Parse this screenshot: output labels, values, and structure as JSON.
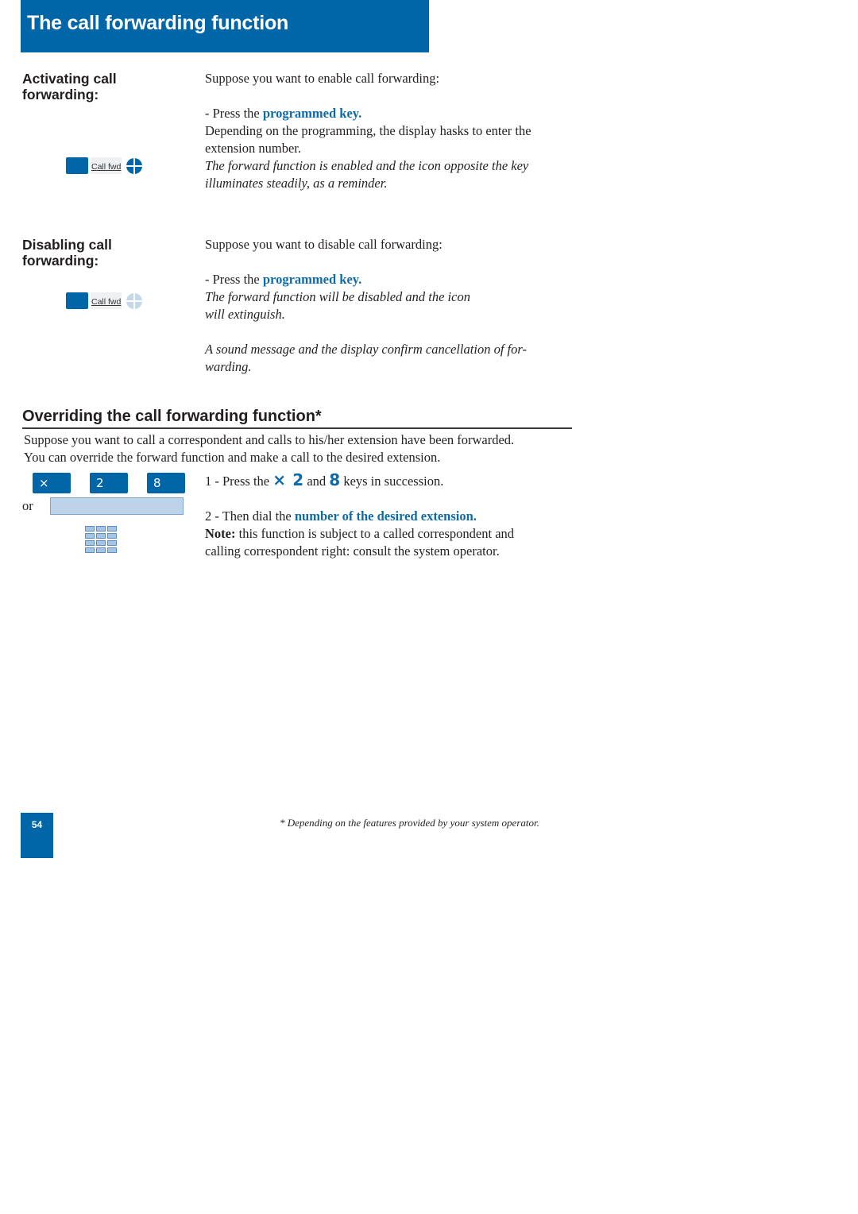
{
  "header": {
    "title": "The call forwarding function",
    "accent_color": "#0066a8"
  },
  "activating": {
    "heading_line1": "Activating call",
    "heading_line2": "forwarding:",
    "key_label": "Call fwd",
    "led_state": "on",
    "intro": "Suppose you want to enable call forwarding:",
    "step_prefix": "- Press the ",
    "step_emph": "programmed key.",
    "line1": "Depending on the programming, the display hasks to enter the",
    "line2": "extension number.",
    "italic1": "The forward function is enabled and the icon opposite the key",
    "italic2": "illuminates steadily, as a reminder."
  },
  "disabling": {
    "heading_line1": "Disabling call",
    "heading_line2": "forwarding:",
    "key_label": "Call fwd",
    "led_state": "off",
    "intro": "Suppose you want to disable call forwarding:",
    "step_prefix": "- Press the ",
    "step_emph": "programmed key.",
    "italic1": "The forward function will be disabled and the icon",
    "italic2": "will extinguish.",
    "italic3": "A sound message and the display confirm cancellation of for-",
    "italic4": "warding."
  },
  "override": {
    "title": "Overriding the call forwarding function*",
    "intro1": "Suppose you want to call a correspondent and calls to his/her extension have been forwarded.",
    "intro2": "You can override the forward function and make a call to the desired extension.",
    "keys": [
      "×",
      "2",
      "8"
    ],
    "or_label": "or",
    "step1_prefix": "1 - Press the ",
    "step1_key1": "×",
    "step1_key2": "2",
    "step1_mid": " and ",
    "step1_key3": "8",
    "step1_suffix": " keys in succession.",
    "step2_prefix": "2 - Then dial the ",
    "step2_emph": "number of the desired extension.",
    "note_label": "Note:",
    "note_text1": " this function is subject to a called correspondent and",
    "note_text2": "calling correspondent right: consult the system operator."
  },
  "footer": {
    "page_number": "54",
    "footnote": "* Depending on the features provided by your system operator."
  }
}
